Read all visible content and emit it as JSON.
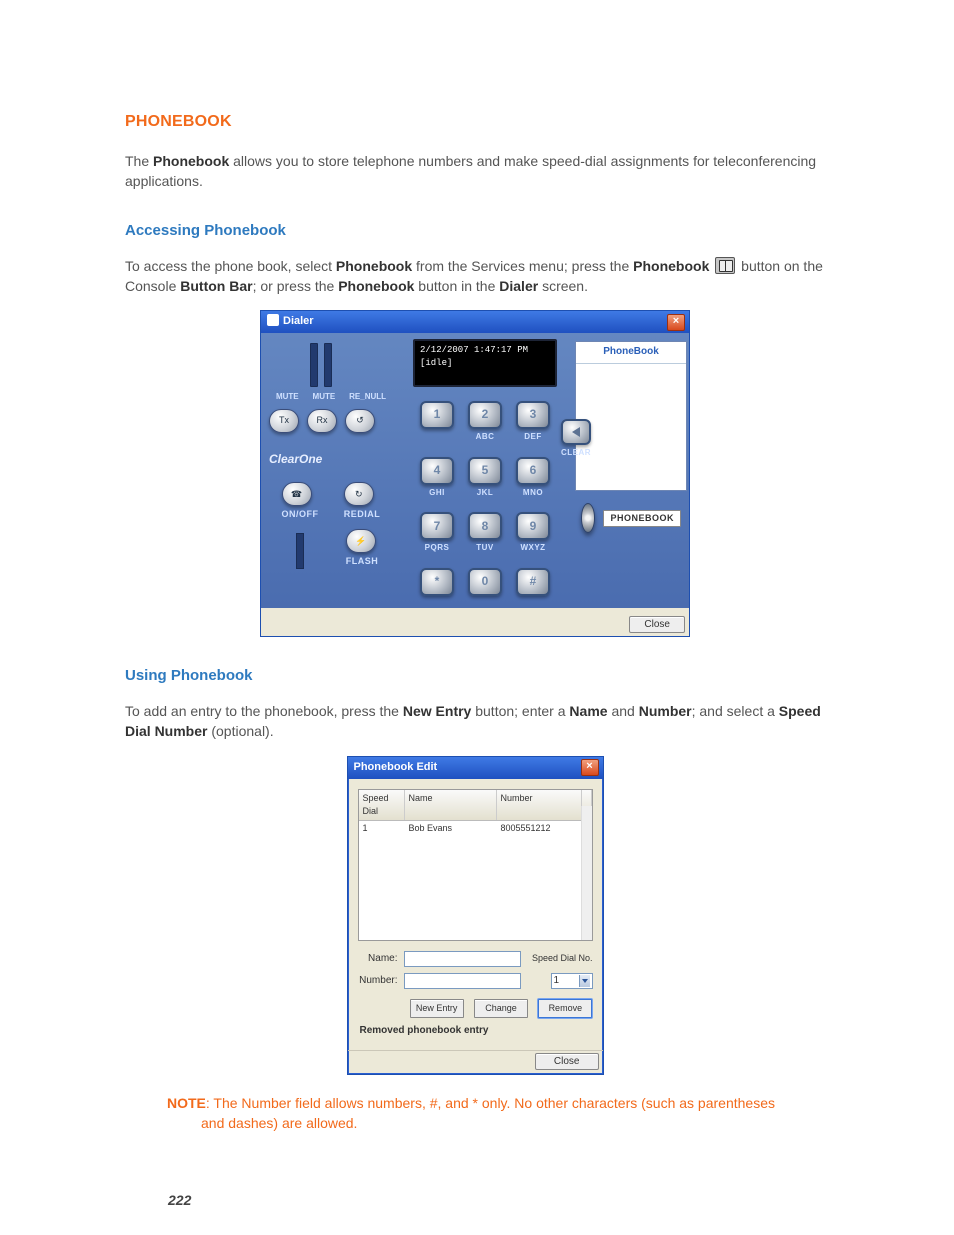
{
  "section_title": "PHONEBOOK",
  "intro": {
    "pre": "The ",
    "bold": "Phonebook",
    "post": " allows you to store telephone numbers and make speed-dial assignments for teleconferencing applications."
  },
  "sub_accessing": "Accessing Phonebook",
  "access_para": {
    "t0": "To access the phone book, select ",
    "b0": "Phonebook",
    "t1": " from the Services menu; press the ",
    "b1": "Phonebook",
    "t2": " button on the Console ",
    "b2": "Button Bar",
    "t3": "; or press the ",
    "b3": "Phonebook",
    "t4": " button in the ",
    "b4": "Dialer",
    "t5": " screen."
  },
  "dialer": {
    "title": "Dialer",
    "close": "×",
    "lcd_line1": "2/12/2007 1:47:17 PM",
    "lcd_line2": "[idle]",
    "mute": "MUTE",
    "re_null": "RE_NULL",
    "brand": "ClearOne",
    "onoff": "ON/OFF",
    "redial": "REDIAL",
    "flash": "FLASH",
    "clear": "CLEAR",
    "phonebook_link": "PhoneBook",
    "phonebook_btn": "PHONEBOOK",
    "close_btn": "Close",
    "keys": {
      "1": {
        "n": "1",
        "l": ""
      },
      "2": {
        "n": "2",
        "l": "ABC"
      },
      "3": {
        "n": "3",
        "l": "DEF"
      },
      "4": {
        "n": "4",
        "l": "GHI"
      },
      "5": {
        "n": "5",
        "l": "JKL"
      },
      "6": {
        "n": "6",
        "l": "MNO"
      },
      "7": {
        "n": "7",
        "l": "PQRS"
      },
      "8": {
        "n": "8",
        "l": "TUV"
      },
      "9": {
        "n": "9",
        "l": "WXYZ"
      },
      "star": {
        "n": "*",
        "l": ""
      },
      "0": {
        "n": "0",
        "l": ""
      },
      "hash": {
        "n": "#",
        "l": ""
      }
    }
  },
  "sub_using": "Using Phonebook",
  "using_para": {
    "t0": "To add an entry to the phonebook, press the ",
    "b0": "New Entry",
    "t1": " button; enter a ",
    "b1": "Name",
    "t2": " and ",
    "b2": "Number",
    "t3": "; and select a ",
    "b3": "Speed Dial Number",
    "t4": " (optional)."
  },
  "pbe": {
    "title": "Phonebook Edit",
    "close": "×",
    "cols": {
      "speed": "Speed Dial",
      "name": "Name",
      "number": "Number"
    },
    "row": {
      "speed": "1",
      "name": "Bob Evans",
      "number": "8005551212"
    },
    "name_label": "Name:",
    "number_label": "Number:",
    "speed_no_label": "Speed Dial No.",
    "speed_value": "1",
    "new_entry": "New Entry",
    "change": "Change",
    "remove": "Remove",
    "status": "Removed phonebook entry",
    "close_btn": "Close"
  },
  "note": {
    "label": "NOTE",
    "line1": ": The Number field allows numbers, #, and * only. No other characters (such as parentheses",
    "line2": "and dashes) are allowed."
  },
  "page_number": "222"
}
